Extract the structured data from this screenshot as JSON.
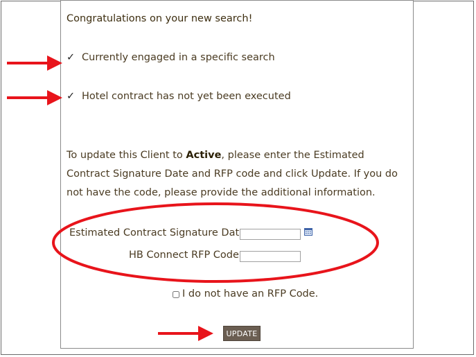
{
  "panel": {
    "title": "Congratulations on your new search!",
    "checks": [
      {
        "mark": "✓",
        "text": "Currently engaged in a specific search"
      },
      {
        "mark": "✓",
        "text": "Hotel contract has not yet been executed"
      }
    ],
    "instructions": {
      "before": "To update this Client to ",
      "emphasis": "Active",
      "after": ", please enter the Estimated Contract Signature Date and RFP code and click Update. If you do not have the code, please provide the additional information."
    },
    "form": {
      "signature_date_label": "Estimated Contract Signature Date:",
      "signature_date_value": "",
      "rfp_code_label": "HB Connect RFP Code:",
      "rfp_code_value": "",
      "no_rfp_label": "I do not have an RFP Code.",
      "no_rfp_checked": false
    },
    "update_button_label": "UPDATE"
  },
  "colors": {
    "annotation_red": "#e8141b",
    "button_bg": "#6b5e52",
    "text": "#4a3b22"
  }
}
